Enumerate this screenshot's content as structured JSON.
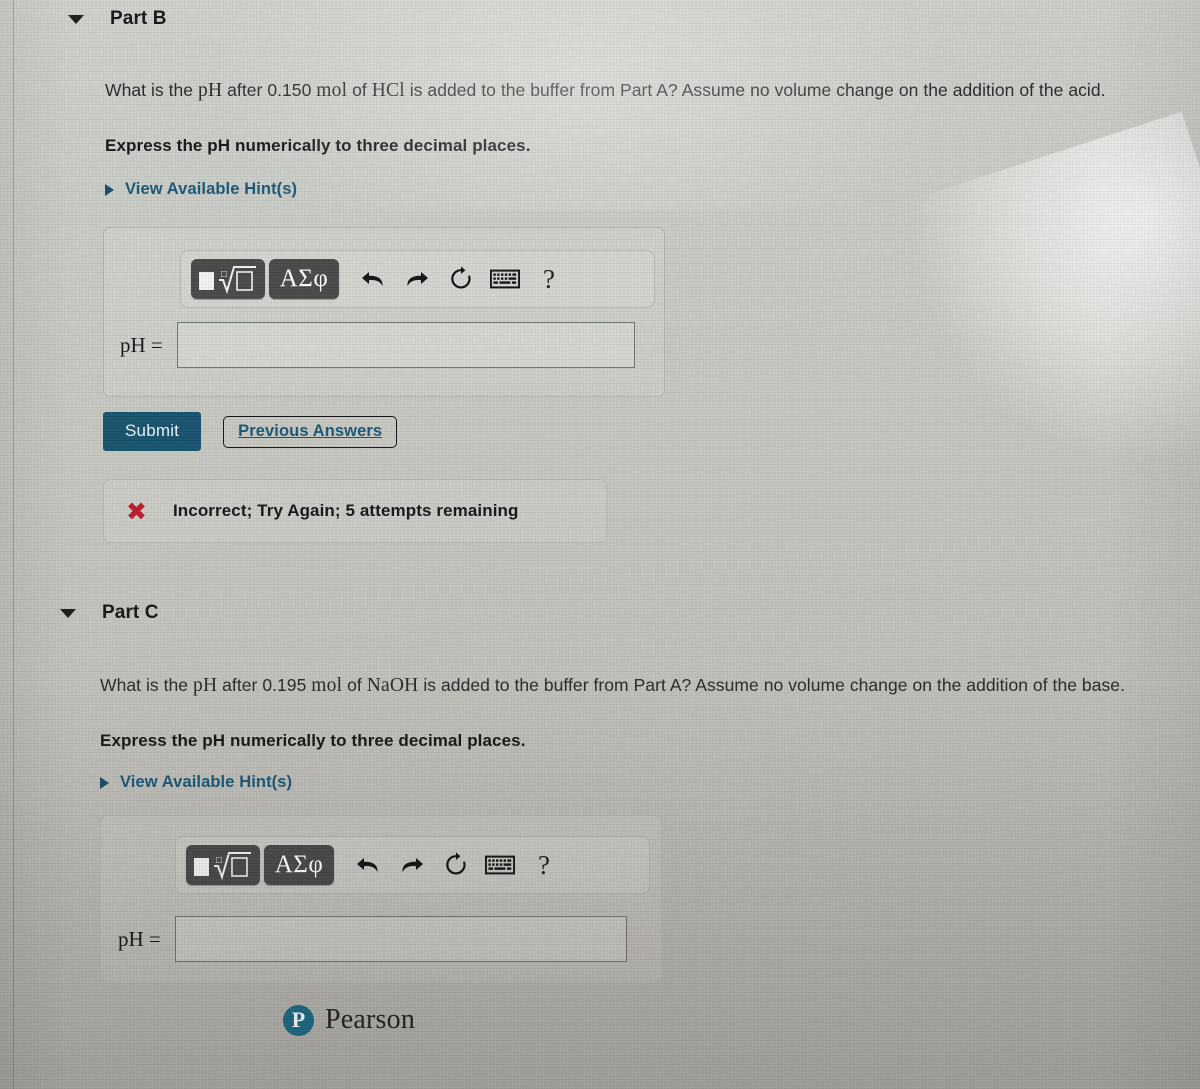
{
  "colors": {
    "submit_bg": "#18536e",
    "link": "#1b5877",
    "incorrect_x": "#bd1a2d",
    "pearson_mark": "#1c6b87",
    "toolbar_btn": "#49494a",
    "page_bg": "#c6c6c0"
  },
  "part_b": {
    "caret_icon": "caret-down-icon",
    "title": "Part B",
    "question_pre": "What is the ",
    "question_math1": "pH",
    "question_mid1": " after 0.150 ",
    "question_math2": "mol",
    "question_mid2": " of ",
    "question_math3": "HCl",
    "question_post": " is added to the buffer from Part A? Assume no volume change on the addition of the acid.",
    "instruction": "Express the pH numerically to three decimal places.",
    "hint_icon": "caret-right-icon",
    "hint_label": "View Available Hint(s)",
    "toolbar": {
      "template_button": "template-editor-button",
      "template_glyph": "■ ⁿ√□",
      "greek_button_label": "ΑΣφ",
      "undo_icon": "undo-icon",
      "redo_icon": "redo-icon",
      "reset_icon": "reset-icon",
      "keyboard_icon": "keyboard-icon",
      "help_label": "?"
    },
    "answer_label": "pH =",
    "answer_value": "",
    "answer_placeholder": "",
    "submit_label": "Submit",
    "previous_answers_label": "Previous Answers",
    "feedback_icon": "x-mark-icon",
    "feedback_mark": "✖",
    "feedback_text": "Incorrect; Try Again; 5 attempts remaining"
  },
  "part_c": {
    "caret_icon": "caret-down-icon",
    "title": "Part C",
    "question_pre": "What is the ",
    "question_math1": "pH",
    "question_mid1": " after 0.195 ",
    "question_math2": "mol",
    "question_mid2": " of ",
    "question_math3": "NaOH",
    "question_post": " is added to the buffer from Part A? Assume no volume change on the addition of the base.",
    "instruction": "Express the pH numerically to three decimal places.",
    "hint_icon": "caret-right-icon",
    "hint_label": "View Available Hint(s)",
    "toolbar": {
      "template_button": "template-editor-button",
      "greek_button_label": "ΑΣφ",
      "undo_icon": "undo-icon",
      "redo_icon": "redo-icon",
      "reset_icon": "reset-icon",
      "keyboard_icon": "keyboard-icon",
      "help_label": "?"
    },
    "answer_label": "pH =",
    "answer_value": "",
    "answer_placeholder": ""
  },
  "footer": {
    "logo_mark": "P",
    "logo_text": "Pearson"
  }
}
